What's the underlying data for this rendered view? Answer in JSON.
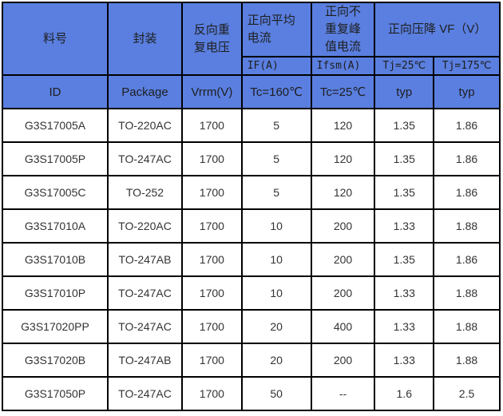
{
  "header": {
    "id_cn": "料号",
    "package_cn": "封装",
    "vrrm_cn": [
      "反向重",
      "复电压"
    ],
    "if_cn": [
      "正向平均",
      "电流"
    ],
    "ifsm_cn": [
      "正向不",
      "重复峰",
      "值电流"
    ],
    "vf_cn": "正向压降 VF（V）",
    "if_sym": "IF(A)",
    "ifsm_sym": "Ifsm(A)",
    "vf_tj25": "Tj=25℃",
    "vf_tj175": "Tj=175℃",
    "id_en": "ID",
    "package_en": "Package",
    "vrrm_en": "Vrrm(V)",
    "if_cond": "Tc=160℃",
    "ifsm_cond": "Tc=25℃",
    "vf25_typ": "typ",
    "vf175_typ": "typ"
  },
  "colors": {
    "header_bg": "#5a7fe0",
    "border": "#000000"
  },
  "rows": [
    [
      "G3S17005A",
      "TO-220AC",
      "1700",
      "5",
      "120",
      "1.35",
      "1.86"
    ],
    [
      "G3S17005P",
      "TO-247AC",
      "1700",
      "5",
      "120",
      "1.35",
      "1.86"
    ],
    [
      "G3S17005C",
      "TO-252",
      "1700",
      "5",
      "120",
      "1.35",
      "1.86"
    ],
    [
      "G3S17010A",
      "TO-220AC",
      "1700",
      "10",
      "200",
      "1.33",
      "1.88"
    ],
    [
      "G3S17010B",
      "TO-247AB",
      "1700",
      "10",
      "200",
      "1.35",
      "1.86"
    ],
    [
      "G3S17010P",
      "TO-247AC",
      "1700",
      "10",
      "200",
      "1.33",
      "1.88"
    ],
    [
      "G3S17020PP",
      "TO-247AC",
      "1700",
      "20",
      "400",
      "1.33",
      "1.88"
    ],
    [
      "G3S17020B",
      "TO-247AB",
      "1700",
      "20",
      "200",
      "1.33",
      "1.88"
    ],
    [
      "G3S17050P",
      "TO-247AC",
      "1700",
      "50",
      "--",
      "1.6",
      "2.5"
    ]
  ]
}
